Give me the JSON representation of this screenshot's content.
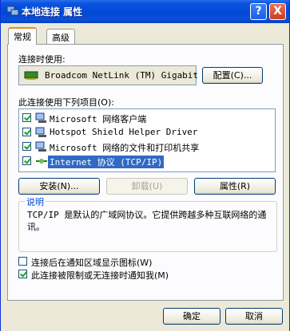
{
  "window": {
    "title": "本地连接 属性",
    "help": "?",
    "close": "X"
  },
  "tabs": [
    "常规",
    "高级"
  ],
  "connect_using": {
    "label": "连接时使用:",
    "adapter": "Broadcom NetLink (TM) Gigabit",
    "configure": "配置(C)..."
  },
  "items_label": "此连接使用下列项目(O):",
  "items": [
    {
      "label": "Microsoft 网络客户端",
      "checked": true
    },
    {
      "label": "Hotspot Shield Helper Driver",
      "checked": true
    },
    {
      "label": "Microsoft 网络的文件和打印机共享",
      "checked": true
    },
    {
      "label": "Internet 协议 (TCP/IP)",
      "checked": true,
      "selected": true
    }
  ],
  "buttons": {
    "install": "安装(N)...",
    "uninstall": "卸载(U)",
    "properties": "属性(R)"
  },
  "description": {
    "title": "说明",
    "text": "TCP/IP 是默认的广域网协议。它提供跨越多种互联网络的通讯。"
  },
  "options": [
    {
      "label": "连接后在通知区域显示图标(W)",
      "checked": false
    },
    {
      "label": "此连接被限制或无连接时通知我(M)",
      "checked": true
    }
  ],
  "footer": {
    "ok": "确定",
    "cancel": "取消"
  },
  "colors": {
    "titlebar": "#0148d6",
    "selection": "#316ac5",
    "group_title": "#0046d5"
  }
}
